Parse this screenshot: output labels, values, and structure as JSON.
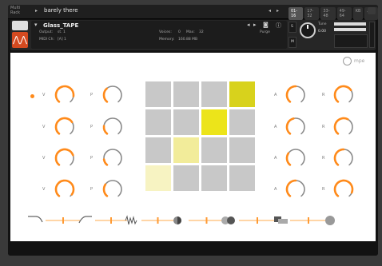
{
  "rack": {
    "label_line1": "Multi",
    "label_line2": "Rack",
    "instrument_name": "barely there",
    "tabs": [
      "01-16",
      "17-32",
      "33-48",
      "49-64",
      "KB",
      "AUX"
    ]
  },
  "header": {
    "title": "Glass_TAPE",
    "output_label": "Output:",
    "output_value": "st. 1",
    "midi_label": "MIDI Ch:",
    "midi_value": "[A] 1",
    "voices_label": "Voices:",
    "voices_value": "0",
    "max_label": "Max:",
    "max_value": "32",
    "memory_label": "Memory:",
    "memory_value": "160.88 MB",
    "purge_label": "Purge",
    "tune_label": "Tune",
    "tune_value": "0.00",
    "s_label": "S",
    "m_label": "M",
    "logo_glyph": "⋀⋀"
  },
  "main": {
    "mpe_label": "mpe",
    "left_rows": [
      {
        "v_label": "V",
        "p_label": "P",
        "v_level": 0.85,
        "p_level": 0.35
      },
      {
        "v_label": "V",
        "p_label": "P",
        "v_level": 0.7,
        "p_level": 0.2
      },
      {
        "v_label": "V",
        "p_label": "P",
        "v_level": 0.75,
        "p_level": 0.15
      },
      {
        "v_label": "V",
        "p_label": "P",
        "v_level": 0.95,
        "p_level": 0.3
      }
    ],
    "right_rows": [
      {
        "a_label": "A",
        "r_label": "R",
        "a_level": 0.5,
        "r_level": 0.7
      },
      {
        "a_label": "A",
        "r_label": "R",
        "a_level": 0.45,
        "r_level": 0.6
      },
      {
        "a_label": "A",
        "r_label": "R",
        "a_level": 0.3,
        "r_level": 0.5
      },
      {
        "a_label": "A",
        "r_label": "R",
        "a_level": 0.5,
        "r_level": 0.9
      }
    ],
    "grid_colors": [
      "#c8c8c8",
      "#c8c8c8",
      "#c8c8c8",
      "#d8d21c",
      "#c8c8c8",
      "#c8c8c8",
      "#ece41a",
      "#c8c8c8",
      "#c8c8c8",
      "#f2ec9a",
      "#c8c8c8",
      "#c8c8c8",
      "#f7f3c2",
      "#c8c8c8",
      "#c8c8c8",
      "#c8c8c8"
    ],
    "fx_icons": [
      "lowpass-icon",
      "highpass-icon",
      "waveform-icon",
      "phaser-icon",
      "chorus-icon",
      "delay-icon",
      "reverb-icon"
    ]
  },
  "colors": {
    "accent": "#ff8a1a",
    "knob_track": "#8a8a8a"
  }
}
